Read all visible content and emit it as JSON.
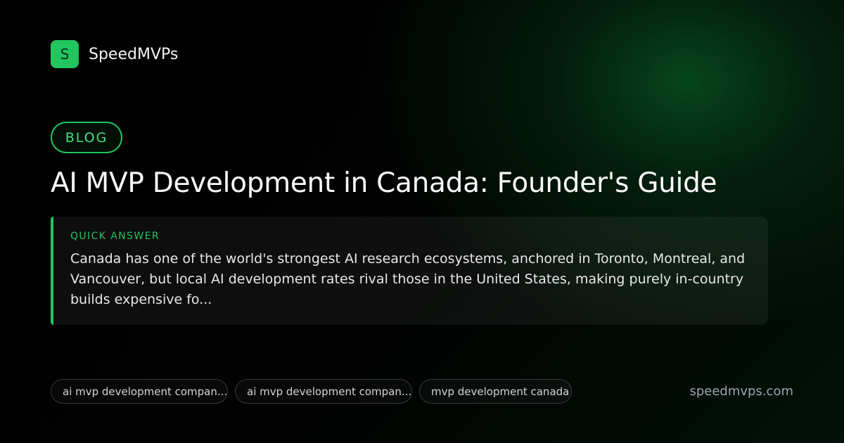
{
  "brand": {
    "logo_letter": "S",
    "name": "SpeedMVPs"
  },
  "badge": "BLOG",
  "title": "AI MVP Development in Canada: Founder's Guide",
  "quick_answer": {
    "label": "QUICK ANSWER",
    "text": "Canada has one of the world's strongest AI research ecosystems, anchored in Toronto, Montreal, and Vancouver,  but local AI development rates rival those in the United States, making purely in-country builds expensive fo..."
  },
  "tags": [
    "ai mvp development compan...",
    "ai mvp development compan...",
    "mvp development canada"
  ],
  "domain": "speedmvps.com",
  "colors": {
    "accent": "#22c55e",
    "background": "#000000",
    "glow": "#0a6e2d"
  }
}
